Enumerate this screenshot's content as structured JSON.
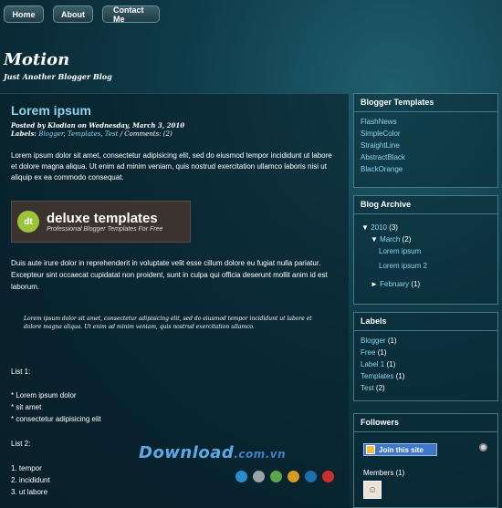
{
  "nav": {
    "home": "Home",
    "about": "About",
    "contact": "Contact Me"
  },
  "blog": {
    "title": "Motion",
    "description": "Just Another Blogger Blog"
  },
  "post": {
    "title": "Lorem ipsum",
    "posted_by": "Posted by Klodian on Wednesday, March 3, 2010",
    "labels_prefix": "Labels:",
    "labels": [
      "Blogger",
      "Templates",
      "Test"
    ],
    "comments": "/ Comments: (2)",
    "paragraph1": "Lorem ipsum dolor sit amet, consectetur adipisicing elit, sed do eiusmod tempor incididunt ut labore et dolore magna aliqua. Ut enim ad minim veniam, quis nostrud exercitation ullamco laboris nisi ut aliquip ex ea commodo consequat.",
    "banner": {
      "logo": "dt",
      "main": "deluxe templates",
      "sub": "Professional Blogger Templates For Free"
    },
    "paragraph2": "Duis aute irure dolor in reprehenderit in voluptate velit esse cillum dolore eu fugiat nulla pariatur. Excepteur sint occaecat cupidatat non proident, sunt in culpa qui officia deserunt mollit anim id est laborum.",
    "quote": "Lorem ipsum dolor sit amet, consectetur adipisicing elit, sed do eiusmod tempor incididunt ut labore et dolore magna aliqua. Ut enim ad minim veniam, quis nostrud exercitation ullamco.",
    "list1_heading": "List 1:",
    "list1": [
      "* Lorem ipsum dolor",
      "* sit amet",
      "* consectetur adipisicing elit"
    ],
    "list2_heading": "List 2:",
    "list2": [
      "1. tempor",
      "2. incididunt",
      "3. ut labore"
    ]
  },
  "sidebar": {
    "templates": {
      "title": "Blogger Templates",
      "items": [
        "FlashNews",
        "SimpleColor",
        "StraightLine",
        "AbstractBlack",
        "BlackOrange"
      ]
    },
    "archive": {
      "title": "Blog Archive",
      "year": "2010",
      "year_count": "(3)",
      "month_open": "March",
      "month_open_count": "(2)",
      "posts": [
        "Lorem ipsum",
        "Lorem ipsum 2"
      ],
      "month_closed": "February",
      "month_closed_count": "(1)",
      "expanded_icon": "triangle-down-icon",
      "collapsed_icon": "triangle-right-icon"
    },
    "labels": {
      "title": "Labels",
      "items": [
        {
          "name": "Blogger",
          "count": "(1)"
        },
        {
          "name": "Free",
          "count": "(1)"
        },
        {
          "name": "Label 1",
          "count": "(1)"
        },
        {
          "name": "Templates",
          "count": "(1)"
        },
        {
          "name": "Test",
          "count": "(2)"
        }
      ]
    },
    "followers": {
      "title": "Followers",
      "join": "Join this site",
      "members": "Members (1)"
    }
  },
  "watermark": {
    "main": "Download",
    "suffix": ".com.vn"
  },
  "colors": {
    "accent": "#8fd3ec",
    "dots": [
      "#2b8ccf",
      "#9aa3a8",
      "#5aa64a",
      "#d79a22",
      "#1e6fae",
      "#cc2f2f"
    ]
  }
}
